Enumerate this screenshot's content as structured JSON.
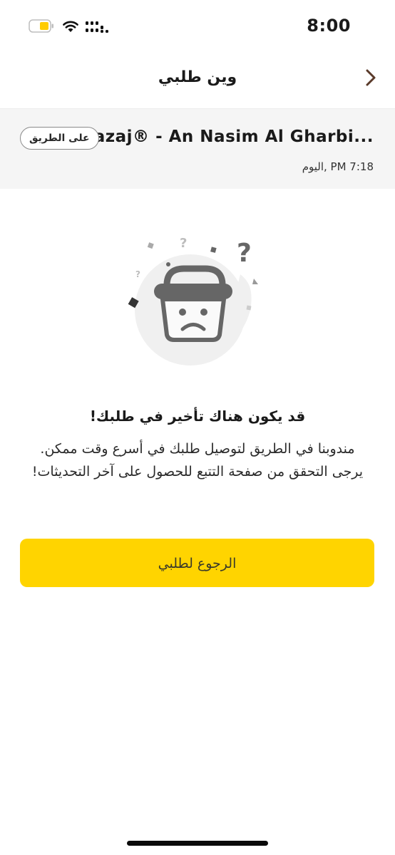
{
  "status_bar": {
    "time": "8:00",
    "battery_color": "#FFCC00"
  },
  "nav": {
    "title": "وين طلبي",
    "back_icon": "chevron-right-icon",
    "accent_color": "#5a3a2a"
  },
  "order": {
    "store_name": "azaj® - An Nasim Al Gharbi...",
    "status": "على الطريق",
    "time": "اليوم, PM 7:18"
  },
  "delay": {
    "heading": "قد يكون هناك تأخير في طلبك!",
    "message_lines": [
      "مندوبنا في الطريق لتوصيل طلبك في أسرع وقت ممكن.",
      "يرجى التحقق من صفحة التتبع للحصول على آخر التحديثات!"
    ],
    "illustration_icon": "sad-basket-icon"
  },
  "actions": {
    "back_to_order_label": "الرجوع لطلبي",
    "button_color": "#FFD400"
  }
}
